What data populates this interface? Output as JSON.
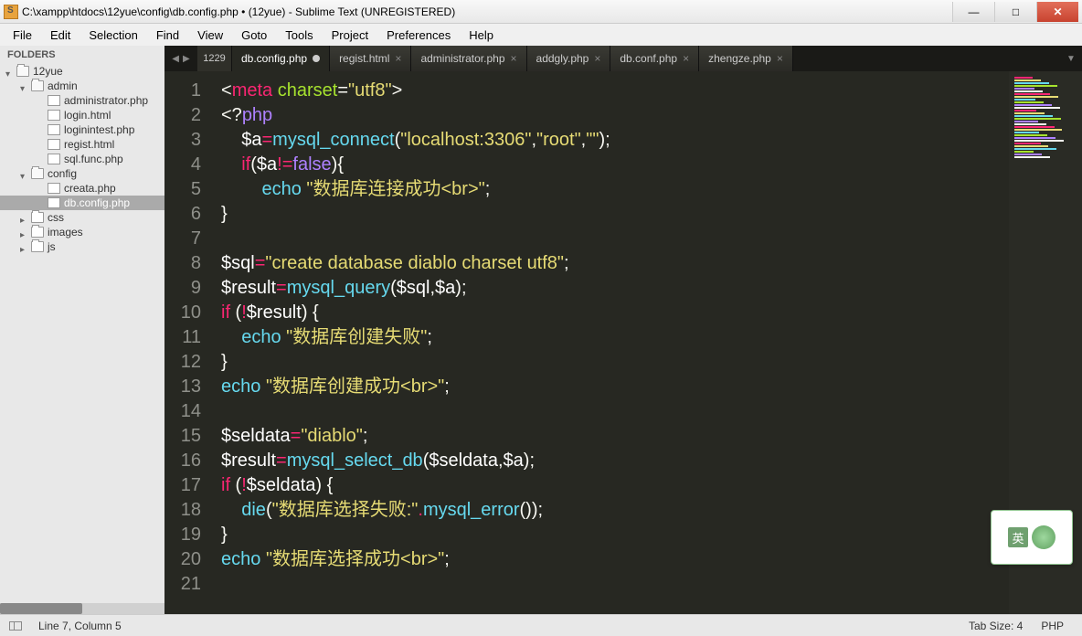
{
  "window": {
    "title": "C:\\xampp\\htdocs\\12yue\\config\\db.config.php • (12yue) - Sublime Text (UNREGISTERED)"
  },
  "menu": [
    "File",
    "Edit",
    "Selection",
    "Find",
    "View",
    "Goto",
    "Tools",
    "Project",
    "Preferences",
    "Help"
  ],
  "sidebar": {
    "header": "FOLDERS",
    "tree": [
      {
        "label": "12yue",
        "type": "folder",
        "open": true,
        "indent": 0
      },
      {
        "label": "admin",
        "type": "folder",
        "open": true,
        "indent": 1
      },
      {
        "label": "administrator.php",
        "type": "file",
        "indent": 2
      },
      {
        "label": "login.html",
        "type": "file",
        "indent": 2
      },
      {
        "label": "loginintest.php",
        "type": "file",
        "indent": 2
      },
      {
        "label": "regist.html",
        "type": "file",
        "indent": 2
      },
      {
        "label": "sql.func.php",
        "type": "file",
        "indent": 2
      },
      {
        "label": "config",
        "type": "folder",
        "open": true,
        "indent": 1
      },
      {
        "label": "creata.php",
        "type": "file",
        "indent": 2
      },
      {
        "label": "db.config.php",
        "type": "file",
        "indent": 2,
        "selected": true
      },
      {
        "label": "css",
        "type": "folder",
        "open": false,
        "indent": 1
      },
      {
        "label": "images",
        "type": "folder",
        "open": false,
        "indent": 1
      },
      {
        "label": "js",
        "type": "folder",
        "open": false,
        "indent": 1
      }
    ]
  },
  "tabs": {
    "overflow": "1229",
    "items": [
      {
        "label": "db.config.php",
        "active": true,
        "dirty": true
      },
      {
        "label": "regist.html",
        "active": false
      },
      {
        "label": "administrator.php",
        "active": false
      },
      {
        "label": "addgly.php",
        "active": false
      },
      {
        "label": "db.conf.php",
        "active": false
      },
      {
        "label": "zhengze.php",
        "active": false
      }
    ]
  },
  "code": {
    "lines": [
      [
        {
          "t": "<",
          "c": "punc"
        },
        {
          "t": "meta",
          "c": "tag"
        },
        {
          "t": " ",
          "c": "punc"
        },
        {
          "t": "charset",
          "c": "attr"
        },
        {
          "t": "=",
          "c": "punc"
        },
        {
          "t": "\"utf8\"",
          "c": "str"
        },
        {
          "t": ">",
          "c": "punc"
        }
      ],
      [
        {
          "t": "<?",
          "c": "punc"
        },
        {
          "t": "php",
          "c": "const"
        }
      ],
      [
        {
          "t": "    ",
          "c": "punc"
        },
        {
          "t": "$a",
          "c": "var"
        },
        {
          "t": "=",
          "c": "op"
        },
        {
          "t": "mysql_connect",
          "c": "func"
        },
        {
          "t": "(",
          "c": "punc"
        },
        {
          "t": "\"localhost:3306\"",
          "c": "str"
        },
        {
          "t": ",",
          "c": "punc"
        },
        {
          "t": "\"root\"",
          "c": "str"
        },
        {
          "t": ",",
          "c": "punc"
        },
        {
          "t": "\"\"",
          "c": "str"
        },
        {
          "t": ");",
          "c": "punc"
        }
      ],
      [
        {
          "t": "    ",
          "c": "punc"
        },
        {
          "t": "if",
          "c": "kw"
        },
        {
          "t": "(",
          "c": "punc"
        },
        {
          "t": "$a",
          "c": "var"
        },
        {
          "t": "!=",
          "c": "op"
        },
        {
          "t": "false",
          "c": "const"
        },
        {
          "t": "){",
          "c": "punc"
        }
      ],
      [
        {
          "t": "        ",
          "c": "punc"
        },
        {
          "t": "echo",
          "c": "func"
        },
        {
          "t": " ",
          "c": "punc"
        },
        {
          "t": "\"数据库连接成功<br>\"",
          "c": "str"
        },
        {
          "t": ";",
          "c": "punc"
        }
      ],
      [
        {
          "t": "}",
          "c": "punc"
        }
      ],
      [
        {
          "t": "    ",
          "c": "punc"
        }
      ],
      [
        {
          "t": "$sql",
          "c": "var"
        },
        {
          "t": "=",
          "c": "op"
        },
        {
          "t": "\"create database diablo charset utf8\"",
          "c": "str"
        },
        {
          "t": ";",
          "c": "punc"
        }
      ],
      [
        {
          "t": "$result",
          "c": "var"
        },
        {
          "t": "=",
          "c": "op"
        },
        {
          "t": "mysql_query",
          "c": "func"
        },
        {
          "t": "(",
          "c": "punc"
        },
        {
          "t": "$sql",
          "c": "var"
        },
        {
          "t": ",",
          "c": "punc"
        },
        {
          "t": "$a",
          "c": "var"
        },
        {
          "t": ");",
          "c": "punc"
        }
      ],
      [
        {
          "t": "if",
          "c": "kw"
        },
        {
          "t": " (",
          "c": "punc"
        },
        {
          "t": "!",
          "c": "op"
        },
        {
          "t": "$result",
          "c": "var"
        },
        {
          "t": ") {",
          "c": "punc"
        }
      ],
      [
        {
          "t": "    ",
          "c": "punc"
        },
        {
          "t": "echo",
          "c": "func"
        },
        {
          "t": " ",
          "c": "punc"
        },
        {
          "t": "\"数据库创建失败\"",
          "c": "str"
        },
        {
          "t": ";",
          "c": "punc"
        }
      ],
      [
        {
          "t": "}",
          "c": "punc"
        }
      ],
      [
        {
          "t": "echo",
          "c": "func"
        },
        {
          "t": " ",
          "c": "punc"
        },
        {
          "t": "\"数据库创建成功<br>\"",
          "c": "str"
        },
        {
          "t": ";",
          "c": "punc"
        }
      ],
      [],
      [
        {
          "t": "$seldata",
          "c": "var"
        },
        {
          "t": "=",
          "c": "op"
        },
        {
          "t": "\"diablo\"",
          "c": "str"
        },
        {
          "t": ";",
          "c": "punc"
        }
      ],
      [
        {
          "t": "$result",
          "c": "var"
        },
        {
          "t": "=",
          "c": "op"
        },
        {
          "t": "mysql_select_db",
          "c": "func"
        },
        {
          "t": "(",
          "c": "punc"
        },
        {
          "t": "$seldata",
          "c": "var"
        },
        {
          "t": ",",
          "c": "punc"
        },
        {
          "t": "$a",
          "c": "var"
        },
        {
          "t": ");",
          "c": "punc"
        }
      ],
      [
        {
          "t": "if",
          "c": "kw"
        },
        {
          "t": " (",
          "c": "punc"
        },
        {
          "t": "!",
          "c": "op"
        },
        {
          "t": "$seldata",
          "c": "var"
        },
        {
          "t": ") {",
          "c": "punc"
        }
      ],
      [
        {
          "t": "    ",
          "c": "punc"
        },
        {
          "t": "die",
          "c": "func"
        },
        {
          "t": "(",
          "c": "punc"
        },
        {
          "t": "\"数据库选择失败:\"",
          "c": "str"
        },
        {
          "t": ".",
          "c": "op"
        },
        {
          "t": "mysql_error",
          "c": "func"
        },
        {
          "t": "());",
          "c": "punc"
        }
      ],
      [
        {
          "t": "}",
          "c": "punc"
        }
      ],
      [
        {
          "t": "echo",
          "c": "func"
        },
        {
          "t": " ",
          "c": "punc"
        },
        {
          "t": "\"数据库选择成功<br>\"",
          "c": "str"
        },
        {
          "t": ";",
          "c": "punc"
        }
      ],
      []
    ]
  },
  "status": {
    "position": "Line 7, Column 5",
    "tabsize": "Tab Size: 4",
    "syntax": "PHP"
  },
  "ime": {
    "char": "英"
  }
}
